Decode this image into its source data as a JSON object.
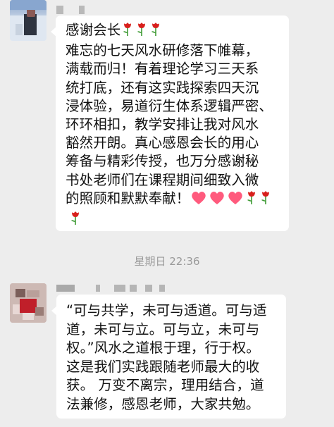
{
  "messages": [
    {
      "lines": [
        "感谢会长",
        "难忘的七天风水研修落下帷幕，",
        "满载而归！有着理论学习三天系",
        "统打底，还有这实践探索四天沉",
        "浸体验，易道衍生体系逻辑严密、",
        "环环相扣，教学安排让我对风水",
        "豁然开朗。真心感恩会长的用心",
        "筹备与精彩传授，也万分感谢秘",
        "书处老师们在课程期间细致入微",
        "的照顾和默默奉献！"
      ],
      "title_emoji": [
        "rose-icon",
        "rose-icon",
        "rose-icon"
      ],
      "trail_emoji": [
        "heart-icon",
        "heart-icon",
        "heart-icon",
        "rose-icon",
        "rose-icon",
        "rose-icon"
      ]
    },
    {
      "lines": [
        "“可与共学，未可与适道。可与适",
        "道，未可与立。可与立，未可与",
        "权。”风水之道根于理，行于权。",
        "这是我们实践跟随老师最大的收",
        "获。 万变不离宗，理用结合，道",
        "法兼修，感恩老师，大家共勉。"
      ]
    }
  ],
  "timestamp": "星期日 22:36",
  "colors": {
    "background": "#ededed",
    "bubble": "#ffffff",
    "text": "#111111",
    "timestamp": "#9a9a9a",
    "heart": "#ff5a7d",
    "rose": "#d8201c",
    "stem": "#3f9b35"
  }
}
